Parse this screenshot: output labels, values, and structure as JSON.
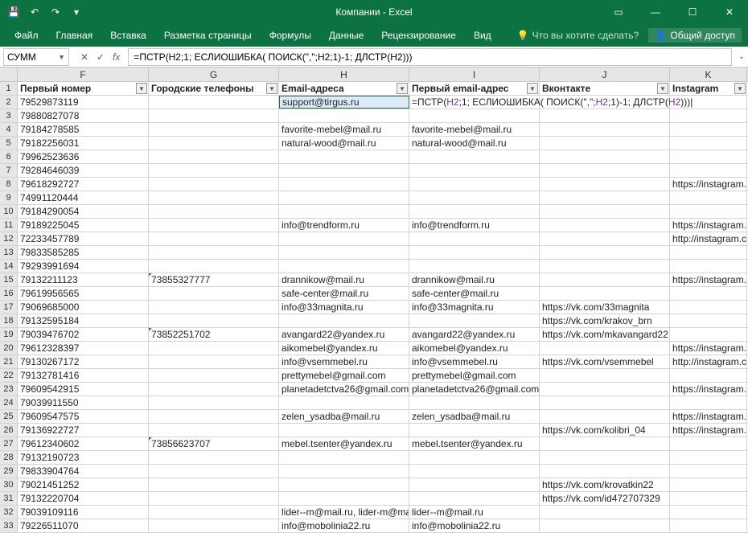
{
  "title": "Компании - Excel",
  "ribbon": {
    "file": "Файл",
    "home": "Главная",
    "insert": "Вставка",
    "layout": "Разметка страницы",
    "formulas": "Формулы",
    "data": "Данные",
    "review": "Рецензирование",
    "view": "Вид",
    "tellme": "Что вы хотите сделать?",
    "share": "Общий доступ"
  },
  "nameBox": "СУММ",
  "formula": "=ПСТР(H2;1; ЕСЛИОШИБКА( ПОИСК(\",\";H2;1)-1; ДЛСТР(H2)))",
  "columns": [
    "F",
    "G",
    "H",
    "I",
    "J",
    "K"
  ],
  "headerRow": {
    "F": "Первый номер",
    "G": "Городские телефоны",
    "H": "Email-адреса",
    "I": "Первый email-адрес",
    "J": "Вконтакте",
    "K": "Instagram"
  },
  "activeFormulaParts": {
    "p1": "=ПСТР(",
    "ref1": "H2",
    "p2": ";1; ЕСЛИОШИБКА( ПОИСК(\",\";",
    "ref2": "H2",
    "p3": ";1)-1; ДЛСТР(",
    "ref3": "H2",
    "p4": ")))"
  },
  "rows": [
    {
      "n": 2,
      "F": "79529873119",
      "G": "",
      "H": "support@tirgus.ru",
      "I": "__FORMULA__",
      "J": "",
      "K": ""
    },
    {
      "n": 3,
      "F": "79880827078",
      "G": "",
      "H": "",
      "I": "",
      "J": "",
      "K": ""
    },
    {
      "n": 4,
      "F": "79184278585",
      "G": "",
      "H": "favorite-mebel@mail.ru",
      "I": "favorite-mebel@mail.ru",
      "J": "",
      "K": ""
    },
    {
      "n": 5,
      "F": "79182256031",
      "G": "",
      "H": "natural-wood@mail.ru",
      "I": "natural-wood@mail.ru",
      "J": "",
      "K": ""
    },
    {
      "n": 6,
      "F": "79962523636",
      "G": "",
      "H": "",
      "I": "",
      "J": "",
      "K": ""
    },
    {
      "n": 7,
      "F": "79284646039",
      "G": "",
      "H": "",
      "I": "",
      "J": "",
      "K": ""
    },
    {
      "n": 8,
      "F": "79618292727",
      "G": "",
      "H": "",
      "I": "",
      "J": "",
      "K": "https://instagram.co"
    },
    {
      "n": 9,
      "F": "74991120444",
      "G": "",
      "H": "",
      "I": "",
      "J": "",
      "K": ""
    },
    {
      "n": 10,
      "F": "79184290054",
      "G": "",
      "H": "",
      "I": "",
      "J": "",
      "K": ""
    },
    {
      "n": 11,
      "F": "79189225045",
      "G": "",
      "H": "info@trendform.ru",
      "I": "info@trendform.ru",
      "J": "",
      "K": "https://instagram.co"
    },
    {
      "n": 12,
      "F": "72233457789",
      "G": "",
      "H": "",
      "I": "",
      "J": "",
      "K": "http://instagram.con"
    },
    {
      "n": 13,
      "F": "79833585285",
      "G": "",
      "H": "",
      "I": "",
      "J": "",
      "K": ""
    },
    {
      "n": 14,
      "F": "79293991694",
      "G": "",
      "H": "",
      "I": "",
      "J": "",
      "K": ""
    },
    {
      "n": 15,
      "F": "79132211123",
      "G": "73855327777",
      "H": "drannikow@mail.ru",
      "I": "drannikow@mail.ru",
      "J": "",
      "K": "https://instagram.co"
    },
    {
      "n": 16,
      "F": "79619956565",
      "G": "",
      "H": "safe-center@mail.ru",
      "I": "safe-center@mail.ru",
      "J": "",
      "K": ""
    },
    {
      "n": 17,
      "F": "79069685000",
      "G": "",
      "H": "info@33magnita.ru",
      "I": "info@33magnita.ru",
      "J": "https://vk.com/33magnita",
      "K": ""
    },
    {
      "n": 18,
      "F": "79132595184",
      "G": "",
      "H": "",
      "I": "",
      "J": "https://vk.com/krakov_brn",
      "K": ""
    },
    {
      "n": 19,
      "F": "79039476702",
      "G": "73852251702",
      "H": "avangard22@yandex.ru",
      "I": "avangard22@yandex.ru",
      "J": "https://vk.com/mkavangard22",
      "K": ""
    },
    {
      "n": 20,
      "F": "79612328397",
      "G": "",
      "H": "aikomebel@yandex.ru",
      "I": "aikomebel@yandex.ru",
      "J": "",
      "K": "https://instagram.co"
    },
    {
      "n": 21,
      "F": "79130267172",
      "G": "",
      "H": "info@vsemmebel.ru",
      "I": "info@vsemmebel.ru",
      "J": "https://vk.com/vsemmebel",
      "K": "http://instagram.con"
    },
    {
      "n": 22,
      "F": "79132781416",
      "G": "",
      "H": "prettymebel@gmail.com",
      "I": "prettymebel@gmail.com",
      "J": "",
      "K": ""
    },
    {
      "n": 23,
      "F": "79609542915",
      "G": "",
      "H": "planetadetctva26@gmail.com",
      "I": "planetadetctva26@gmail.com",
      "J": "",
      "K": "https://instagram.co"
    },
    {
      "n": 24,
      "F": "79039911550",
      "G": "",
      "H": "",
      "I": "",
      "J": "",
      "K": ""
    },
    {
      "n": 25,
      "F": "79609547575",
      "G": "",
      "H": "zelen_ysadba@mail.ru",
      "I": "zelen_ysadba@mail.ru",
      "J": "",
      "K": "https://instagram.co"
    },
    {
      "n": 26,
      "F": "79136922727",
      "G": "",
      "H": "",
      "I": "",
      "J": "https://vk.com/kolibri_04",
      "K": "https://instagram.co"
    },
    {
      "n": 27,
      "F": "79612340602",
      "G": "73856623707",
      "H": "mebel.tsenter@yandex.ru",
      "I": "mebel.tsenter@yandex.ru",
      "J": "",
      "K": ""
    },
    {
      "n": 28,
      "F": "79132190723",
      "G": "",
      "H": "",
      "I": "",
      "J": "",
      "K": ""
    },
    {
      "n": 29,
      "F": "79833904764",
      "G": "",
      "H": "",
      "I": "",
      "J": "",
      "K": ""
    },
    {
      "n": 30,
      "F": "79021451252",
      "G": "",
      "H": "",
      "I": "",
      "J": "https://vk.com/krovatkin22",
      "K": ""
    },
    {
      "n": 31,
      "F": "79132220704",
      "G": "",
      "H": "",
      "I": "",
      "J": "https://vk.com/id472707329",
      "K": ""
    },
    {
      "n": 32,
      "F": "79039109116",
      "G": "",
      "H": "lider--m@mail.ru, lider-m@mai",
      "I": "lider--m@mail.ru",
      "J": "",
      "K": ""
    },
    {
      "n": 33,
      "F": "79226511070",
      "G": "",
      "H": "info@mobolinia22.ru",
      "I": "info@mobolinia22.ru",
      "J": "",
      "K": ""
    }
  ]
}
